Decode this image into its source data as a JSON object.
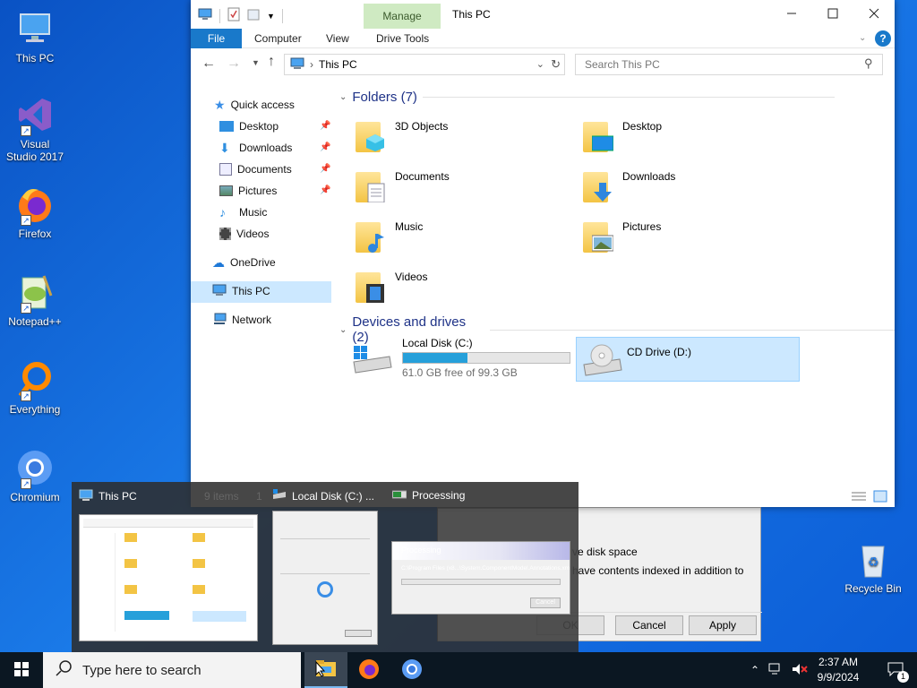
{
  "desktop": {
    "icons": [
      {
        "label": "This PC"
      },
      {
        "label": "Visual Studio 2017"
      },
      {
        "label": "Firefox"
      },
      {
        "label": "Notepad++"
      },
      {
        "label": "Everything"
      },
      {
        "label": "Chromium"
      },
      {
        "label": "Recycle Bin"
      }
    ]
  },
  "explorer": {
    "title": "This PC",
    "manage_tab": "Manage",
    "ribbon_tabs": [
      "File",
      "Computer",
      "View",
      "Drive Tools"
    ],
    "address": "This PC",
    "search_placeholder": "Search This PC",
    "nav": {
      "quick_access": "Quick access",
      "quick_items": [
        "Desktop",
        "Downloads",
        "Documents",
        "Pictures",
        "Music",
        "Videos"
      ],
      "onedrive": "OneDrive",
      "this_pc": "This PC",
      "network": "Network"
    },
    "folders_header": "Folders (7)",
    "folders": [
      "3D Objects",
      "Desktop",
      "Documents",
      "Downloads",
      "Music",
      "Pictures",
      "Videos"
    ],
    "drives_header": "Devices and drives (2)",
    "drives": [
      {
        "name": "Local Disk (C:)",
        "free": "61.0 GB free of 99.3 GB",
        "used_fraction": 0.386
      },
      {
        "name": "CD Drive (D:)"
      }
    ],
    "status": {
      "items": "9 items",
      "selected": "1"
    }
  },
  "switcher": {
    "windows": [
      {
        "title": "This PC"
      },
      {
        "title": "Local Disk (C:) ..."
      },
      {
        "title": "Processing"
      }
    ],
    "processing_title": "Processing",
    "processing_path": "C:\\Program Files (x8...\\System.ComponentModel.Annotations.xml",
    "processing_cancel": "Cancel"
  },
  "bg_dialog": {
    "text1": "ve disk space",
    "text2": "have contents indexed in addition to",
    "ok": "OK",
    "cancel": "Cancel",
    "apply": "Apply"
  },
  "taskbar": {
    "search_placeholder": "Type here to search",
    "time": "2:37 AM",
    "date": "9/9/2024",
    "notif_count": "1"
  }
}
